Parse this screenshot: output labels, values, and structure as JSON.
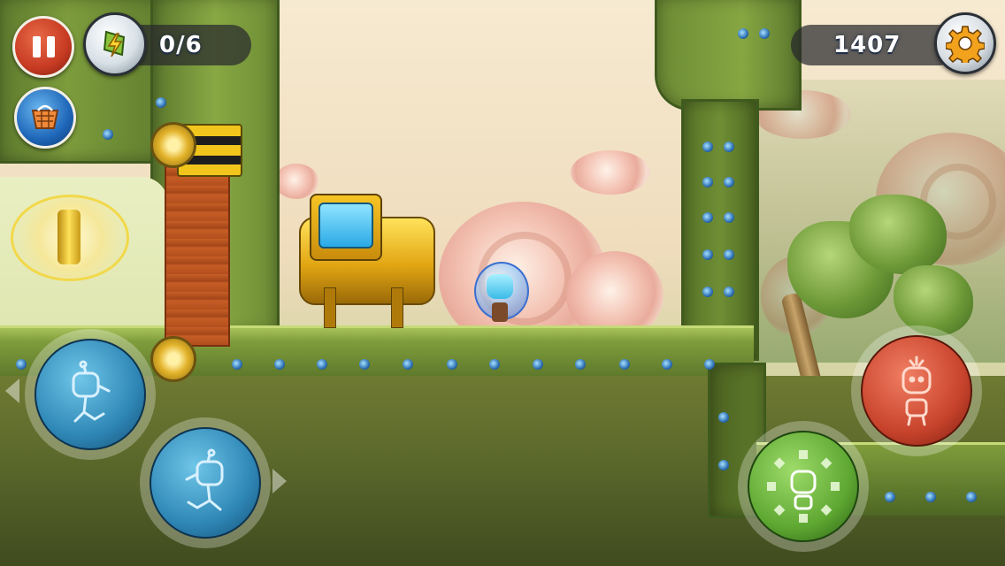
{
  "hud": {
    "pause_icon": "pause-icon",
    "energy_icon": "lightning-badge-icon",
    "collected_counter": "0/6",
    "shop_icon": "shopping-basket-icon",
    "gear_score": "1407",
    "gear_icon": "gear-icon"
  },
  "controls": {
    "left": "move-left-robot-icon",
    "right": "move-right-robot-icon",
    "jump": "jump-robot-icon",
    "action": "transform-robot-icon"
  },
  "colors": {
    "pause_red": "#c63a22",
    "shop_blue": "#1e66b8",
    "control_blue": "#2f87b6",
    "control_red": "#c8432c",
    "control_green": "#5ea832",
    "wall_green": "#6d8c35"
  }
}
